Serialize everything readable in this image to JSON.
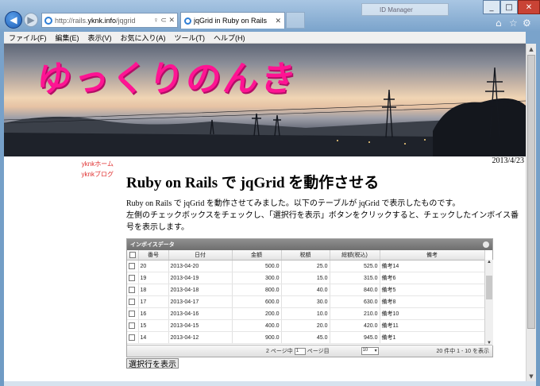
{
  "browser": {
    "address_url_gray": "http://rails.",
    "address_url_black": "yknk.info",
    "address_url_path": "/jqgrid",
    "address_controls": "♀ ⊂ ✕",
    "tab_title": "jqGrid in Ruby on Rails",
    "background_window": "ID Manager"
  },
  "menu": [
    "ファイル(F)",
    "編集(E)",
    "表示(V)",
    "お気に入り(A)",
    "ツール(T)",
    "ヘルプ(H)"
  ],
  "page": {
    "logo_text": "ゆっくりのんき",
    "side_links": [
      "yknkホーム",
      "yknkブログ"
    ],
    "date": "2013/4/23",
    "heading": "Ruby on Rails で jqGrid を動作させる",
    "paragraph_line1": "Ruby on Rails で jqGrid を動作させてみました。以下のテーブルが jqGrid で表示したものです。",
    "paragraph_line2": "左側のチェックボックスをチェックし、「選択行を表示」ボタンをクリックすると、チェックしたインボイス番号を表示します。",
    "show_button": "選択行を表示"
  },
  "grid": {
    "caption": "インボイスデータ",
    "columns": [
      "番号",
      "日付",
      "金額",
      "税額",
      "総額(税込)",
      "備考"
    ],
    "rows": [
      {
        "id": "20",
        "date": "2013-04-20",
        "amount": "500.0",
        "tax": "25.0",
        "total": "525.0",
        "note": "備考14"
      },
      {
        "id": "19",
        "date": "2013-04-19",
        "amount": "300.0",
        "tax": "15.0",
        "total": "315.0",
        "note": "備考6"
      },
      {
        "id": "18",
        "date": "2013-04-18",
        "amount": "800.0",
        "tax": "40.0",
        "total": "840.0",
        "note": "備考5"
      },
      {
        "id": "17",
        "date": "2013-04-17",
        "amount": "600.0",
        "tax": "30.0",
        "total": "630.0",
        "note": "備考8"
      },
      {
        "id": "16",
        "date": "2013-04-16",
        "amount": "200.0",
        "tax": "10.0",
        "total": "210.0",
        "note": "備考10"
      },
      {
        "id": "15",
        "date": "2013-04-15",
        "amount": "400.0",
        "tax": "20.0",
        "total": "420.0",
        "note": "備考11"
      },
      {
        "id": "14",
        "date": "2013-04-12",
        "amount": "900.0",
        "tax": "45.0",
        "total": "945.0",
        "note": "備考1"
      }
    ],
    "pager": {
      "page_prefix": "2 ページ中",
      "page_value": "1",
      "page_suffix": "ページ目",
      "rows_select": "10",
      "record_info": "20 件中 1 - 10 を表示"
    }
  }
}
